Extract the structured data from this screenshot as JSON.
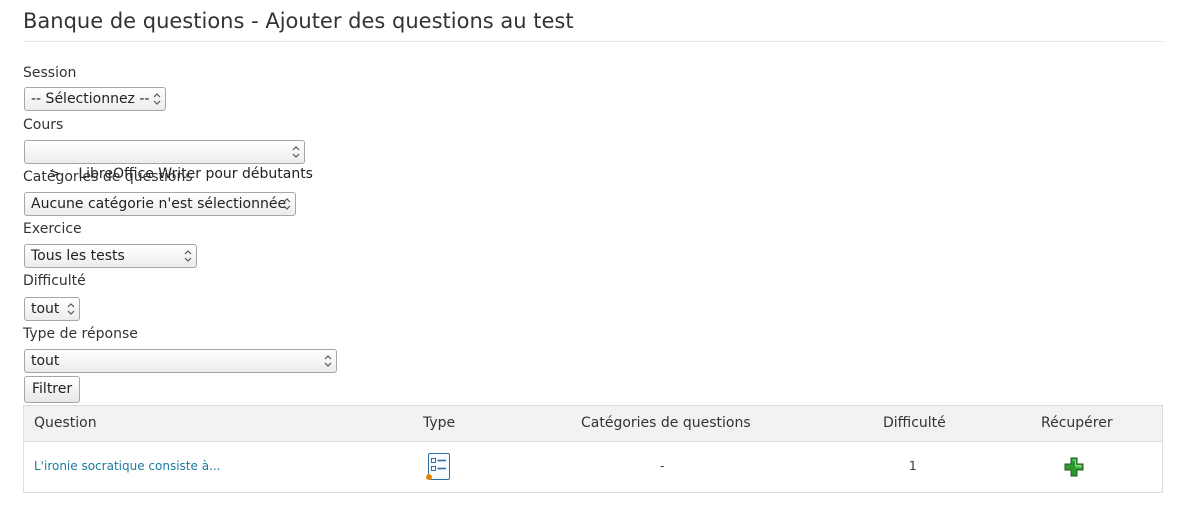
{
  "page_title": "Banque de questions - Ajouter des questions au test",
  "filters": {
    "session": {
      "label": "Session",
      "value": "-- Sélectionnez --"
    },
    "course": {
      "label": "Cours",
      "value": ">    LibreOffice Writer pour débutants"
    },
    "category": {
      "label": "Catégories de questions",
      "value": "Aucune catégorie n'est sélectionnée"
    },
    "exercise": {
      "label": "Exercice",
      "value": "Tous les tests"
    },
    "difficulty": {
      "label": "Difficulté",
      "value": "tout"
    },
    "answer_type": {
      "label": "Type de réponse",
      "value": "tout"
    },
    "filter_button": "Filtrer"
  },
  "table": {
    "headers": {
      "question": "Question",
      "type": "Type",
      "categories": "Catégories de questions",
      "difficulty": "Difficulté",
      "recover": "Récupérer"
    },
    "rows": [
      {
        "question": "L'ironie socratique consiste à...",
        "type_icon": "multiple-choice-icon",
        "categories": "-",
        "difficulty": "1",
        "recover_icon": "add-plus-icon"
      }
    ]
  },
  "colors": {
    "link": "#1a7a9e",
    "add_icon": "#2e9a2e"
  }
}
